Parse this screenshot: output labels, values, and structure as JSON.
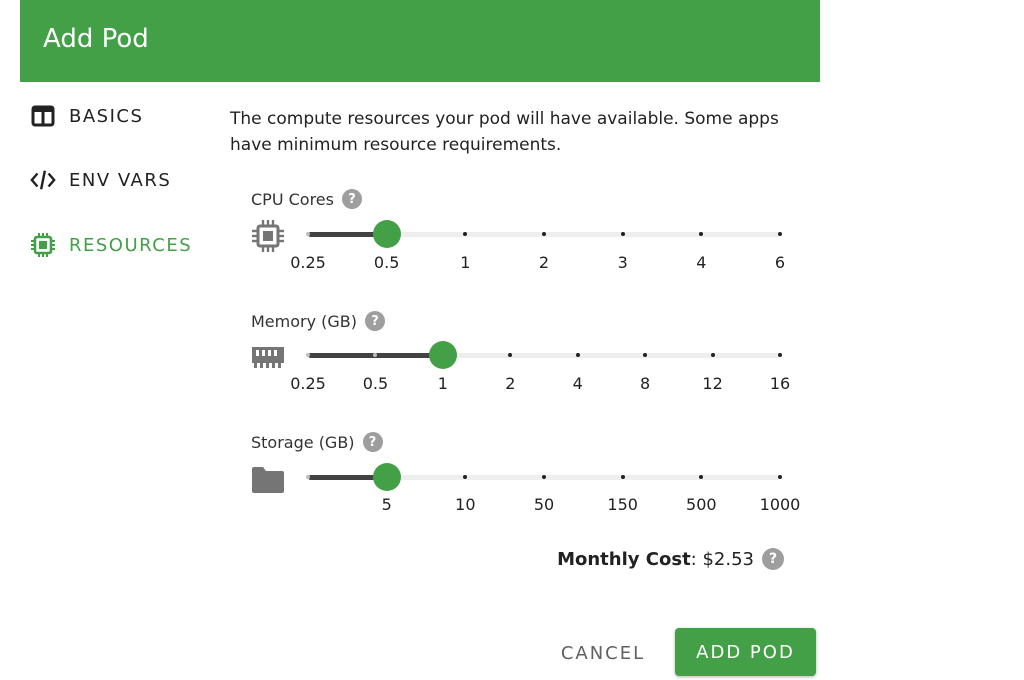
{
  "dialog": {
    "title": "Add Pod"
  },
  "nav": {
    "items": [
      {
        "label": "BASICS",
        "icon": "columns-icon",
        "active": false
      },
      {
        "label": "ENV VARS",
        "icon": "code-icon",
        "active": false
      },
      {
        "label": "RESOURCES",
        "icon": "chip-icon",
        "active": true
      }
    ],
    "active_color": "#43a047"
  },
  "resources": {
    "description": "The compute resources your pod will have available. Some apps have minimum resource requirements.",
    "cpu": {
      "label": "CPU Cores",
      "help": "?",
      "icon": "cpu-chip-icon",
      "ticks": [
        "0.25",
        "0.5",
        "1",
        "2",
        "3",
        "4",
        "6"
      ],
      "selected_value": "0.5"
    },
    "memory": {
      "label": "Memory (GB)",
      "help": "?",
      "icon": "memory-icon",
      "ticks": [
        "0.25",
        "0.5",
        "1",
        "2",
        "4",
        "8",
        "12",
        "16"
      ],
      "selected_value": "1"
    },
    "storage": {
      "label": "Storage (GB)",
      "help": "?",
      "icon": "folder-icon",
      "ticks": [
        "",
        "5",
        "10",
        "50",
        "150",
        "500",
        "1000"
      ],
      "selected_value": "5"
    },
    "cost": {
      "label": "Monthly Cost",
      "value": "$2.53",
      "help": "?"
    }
  },
  "actions": {
    "cancel": "CANCEL",
    "submit": "ADD POD"
  },
  "colors": {
    "primary": "#43a047",
    "slider_fill": "#424242",
    "rail": "#eeeeee"
  }
}
